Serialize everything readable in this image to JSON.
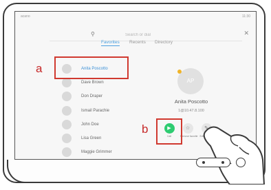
{
  "status": {
    "left": "acano",
    "right": "11:30"
  },
  "search": {
    "placeholder": "Search or dial"
  },
  "tabs": [
    "Favorites",
    "Recents",
    "Directory"
  ],
  "contacts": [
    {
      "name": "Anita Poscotto",
      "selected": true
    },
    {
      "name": "Dave Brown"
    },
    {
      "name": "Don Draper"
    },
    {
      "name": "Ismail Parachie"
    },
    {
      "name": "John Doe"
    },
    {
      "name": "Lisa Green"
    },
    {
      "name": "Maggie Grimmer"
    }
  ],
  "detail": {
    "initials": "AP",
    "name": "Anita Poscotto",
    "address": "1@10.47.8.100"
  },
  "actions": [
    {
      "label": "Call",
      "icon": "camera-icon",
      "color": "#2ecc71"
    },
    {
      "label": "Remove favorite",
      "icon": "star-icon",
      "color": "#e6e6e6"
    },
    {
      "label": "Edit and call",
      "icon": "pencil-icon",
      "color": "#e6e6e6"
    }
  ],
  "callouts": {
    "a": "a",
    "b": "b"
  }
}
